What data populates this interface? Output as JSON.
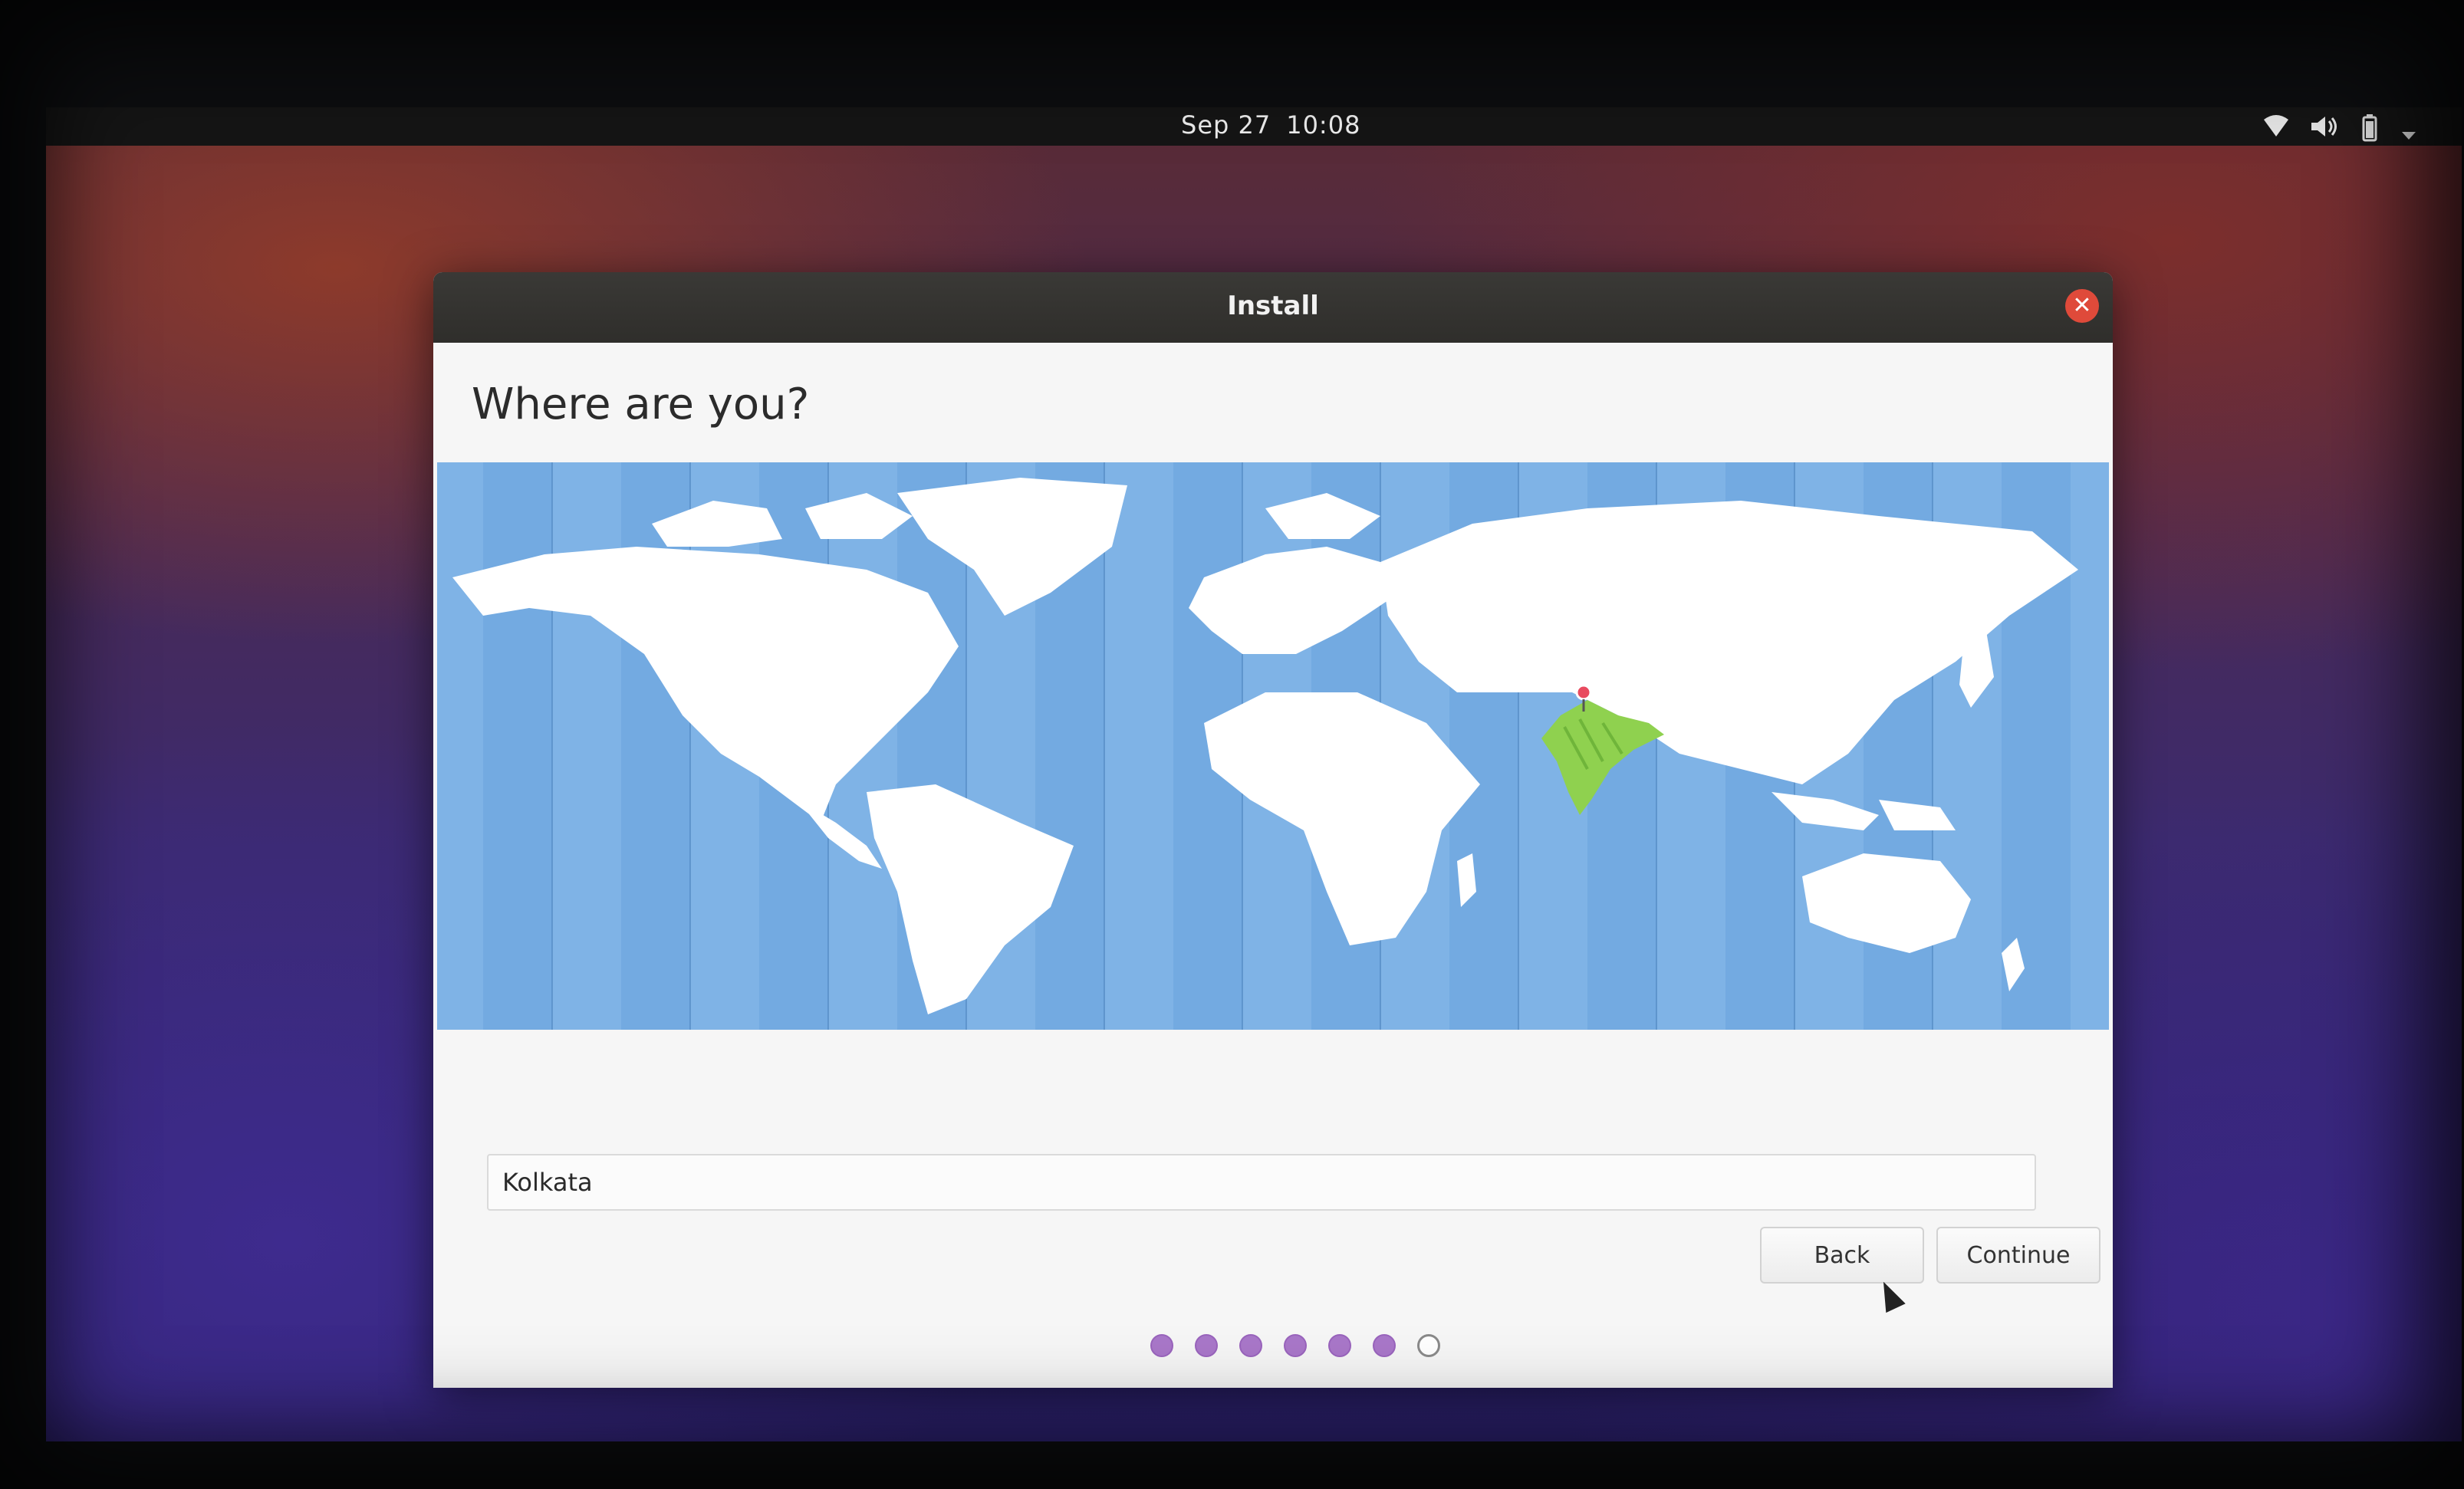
{
  "topbar": {
    "date": "Sep 27",
    "time": "10:08",
    "icons": [
      "wifi-icon",
      "volume-icon",
      "battery-icon",
      "system-menu-chevron-icon"
    ]
  },
  "window": {
    "title": "Install",
    "close_icon": "close-icon"
  },
  "page": {
    "heading": "Where are you?"
  },
  "map": {
    "selected_region": "India",
    "highlight_color": "#8fd14f",
    "ocean_color": "#7fb3e6",
    "land_color": "#ffffff",
    "pin_icon": "location-pin-icon"
  },
  "location_field": {
    "value": "Kolkata"
  },
  "buttons": {
    "back": "Back",
    "continue": "Continue"
  },
  "progress": {
    "total_steps": 7,
    "completed_steps": 6,
    "accent": "#a977c9"
  }
}
